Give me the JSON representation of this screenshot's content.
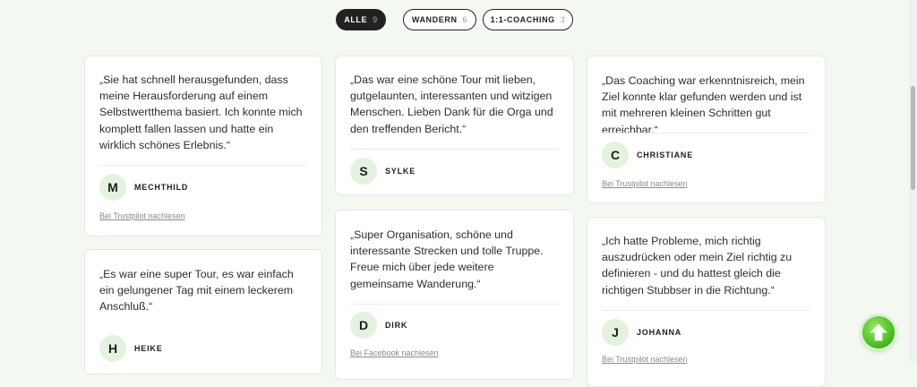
{
  "filters": [
    {
      "label": "ALLE",
      "count": "9"
    },
    {
      "label": "WANDERN",
      "count": "6"
    },
    {
      "label": "1:1-COACHING",
      "count": "3"
    }
  ],
  "testimonials": [
    {
      "quote": "„Sie hat schnell herausgefunden, dass meine Herausforderung auf einem Selbstwertthema basiert. Ich konnte mich komplett fallen lassen und hatte ein wirklich schönes Erlebnis.“",
      "initial": "M",
      "name": "MECHTHILD",
      "source": "Bei Trustpilot nachlesen"
    },
    {
      "quote": "„Es war eine super Tour, es war einfach ein gelungener Tag mit einem leckerem Anschluß.“",
      "initial": "H",
      "name": "HEIKE",
      "source": ""
    },
    {
      "quote": "„Das war eine schöne Tour mit lieben, gutgelaunten, interessanten und witzigen Menschen. Lieben Dank für die Orga und den treffenden Bericht.“",
      "initial": "S",
      "name": "SYLKE",
      "source": ""
    },
    {
      "quote": "„Super Organisation, schöne und interessante Strecken und tolle Truppe. Freue mich über jede weitere gemeinsame Wanderung.“",
      "initial": "D",
      "name": "DIRK",
      "source": "Bei Facebook nachlesen"
    },
    {
      "quote": "„Das Coaching war erkenntnisreich, mein Ziel konnte klar gefunden werden und ist mit mehreren kleinen Schritten gut erreichbar.“",
      "initial": "C",
      "name": "CHRISTIANE",
      "source": "Bei Trustpilot nachlesen"
    },
    {
      "quote": "„Ich hatte Probleme, mich richtig auszudrücken oder mein Ziel richtig zu definieren - und du hattest gleich die richtigen Stubbser in die Richtung.“",
      "initial": "J",
      "name": "JOHANNA",
      "source": "Bei Trustpilot nachlesen"
    }
  ],
  "icons": {
    "back_to_top": "arrow-up-icon"
  },
  "colors": {
    "page_bg": "#f3f8f1",
    "active_chip": "#222222",
    "avatar_bg": "#e4f3df",
    "to_top": "#52c22a"
  }
}
